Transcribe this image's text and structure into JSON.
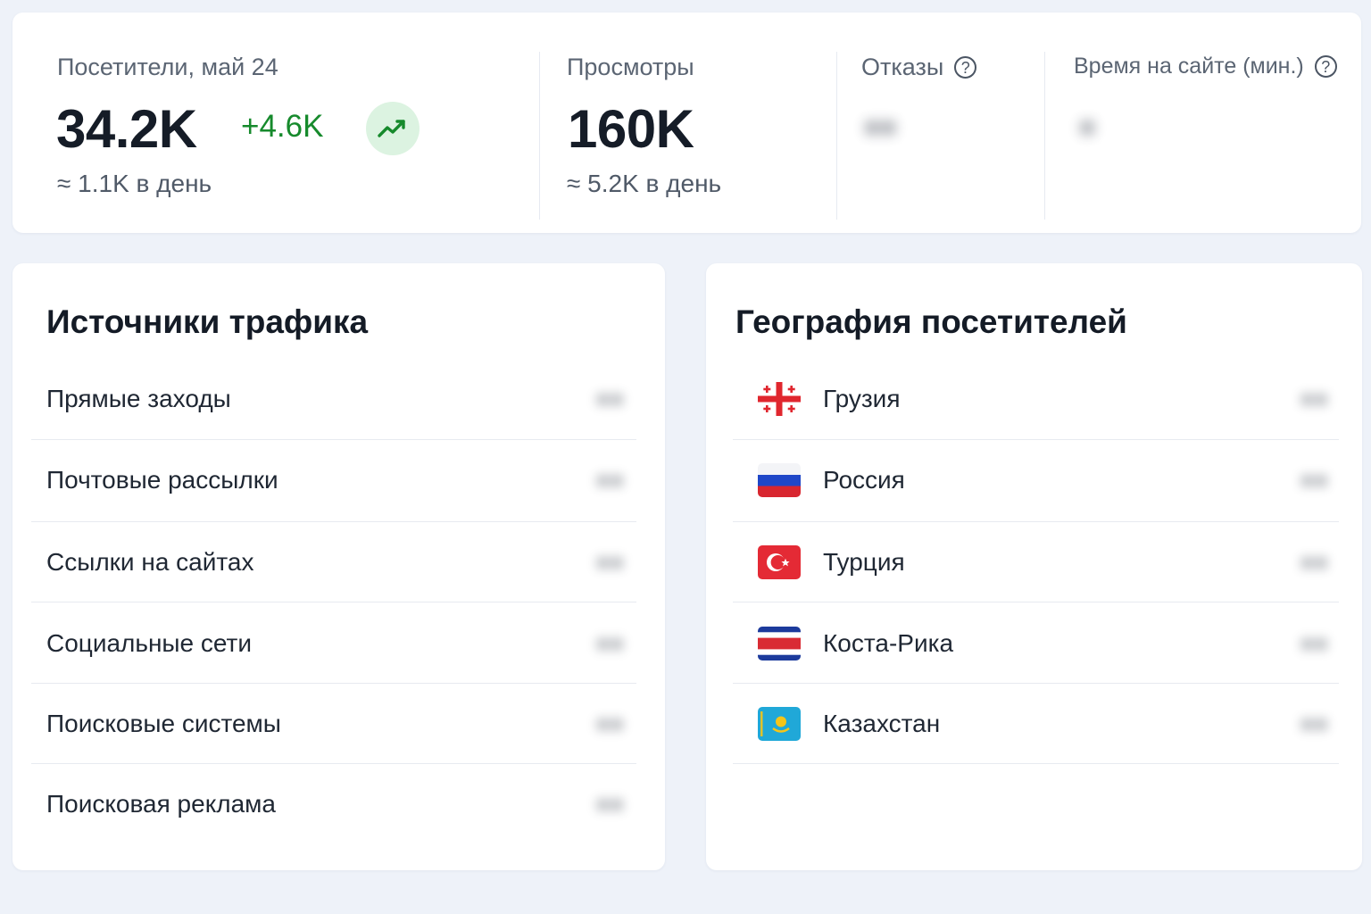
{
  "stats": {
    "visitors": {
      "label": "Посетители, май 24",
      "value": "34.2K",
      "delta": "+4.6K",
      "trend_icon": "trending-up-icon",
      "per_day": "≈ 1.1K в день"
    },
    "views": {
      "label": "Просмотры",
      "value": "160K",
      "per_day": "≈ 5.2K в день"
    },
    "bounces": {
      "label": "Отказы",
      "help_icon": "question-circle-icon",
      "help_glyph": "?"
    },
    "time_on_site": {
      "label": "Время на сайте (мин.)",
      "help_icon": "question-circle-icon",
      "help_glyph": "?"
    }
  },
  "traffic_sources": {
    "title": "Источники трафика",
    "items": [
      {
        "label": "Прямые заходы"
      },
      {
        "label": "Почтовые рассылки"
      },
      {
        "label": "Ссылки на сайтах"
      },
      {
        "label": "Социальные сети"
      },
      {
        "label": "Поисковые системы"
      },
      {
        "label": "Поисковая реклама"
      }
    ]
  },
  "geography": {
    "title": "География посетителей",
    "items": [
      {
        "label": "Грузия",
        "flag": "georgia-flag-icon"
      },
      {
        "label": "Россия",
        "flag": "russia-flag-icon"
      },
      {
        "label": "Турция",
        "flag": "turkey-flag-icon"
      },
      {
        "label": "Коста-Рика",
        "flag": "costa-rica-flag-icon"
      },
      {
        "label": "Казахстан",
        "flag": "kazakhstan-flag-icon"
      }
    ]
  },
  "colors": {
    "background": "#eef2f9",
    "card": "#ffffff",
    "positive": "#168a2c",
    "positive_badge": "#dcf3e1"
  }
}
